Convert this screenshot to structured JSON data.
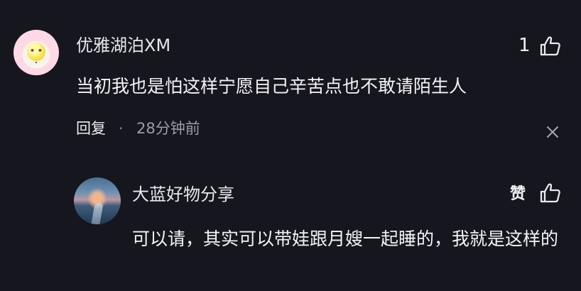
{
  "comment": {
    "author": "优雅湖泊XM",
    "like_count": "1",
    "text": "当初我也是怕这样宁愿自己辛苦点也不敢请陌生人",
    "reply_label": "回复",
    "separator": "·",
    "time": "28分钟前",
    "avatar_icon": "fried-egg-icon",
    "like_icon": "thumbs-up-icon",
    "close_icon": "close-icon"
  },
  "reply": {
    "author": "大蓝好物分享",
    "like_label": "赞",
    "text": "可以请，其实可以带娃跟月嫂一起睡的，我就是这样的",
    "like_icon": "thumbs-up-icon"
  },
  "colors": {
    "background": "#16161e",
    "text": "#f4f4f7",
    "muted": "#9c9ca4",
    "avatar_ring": "#ffd9e6"
  }
}
